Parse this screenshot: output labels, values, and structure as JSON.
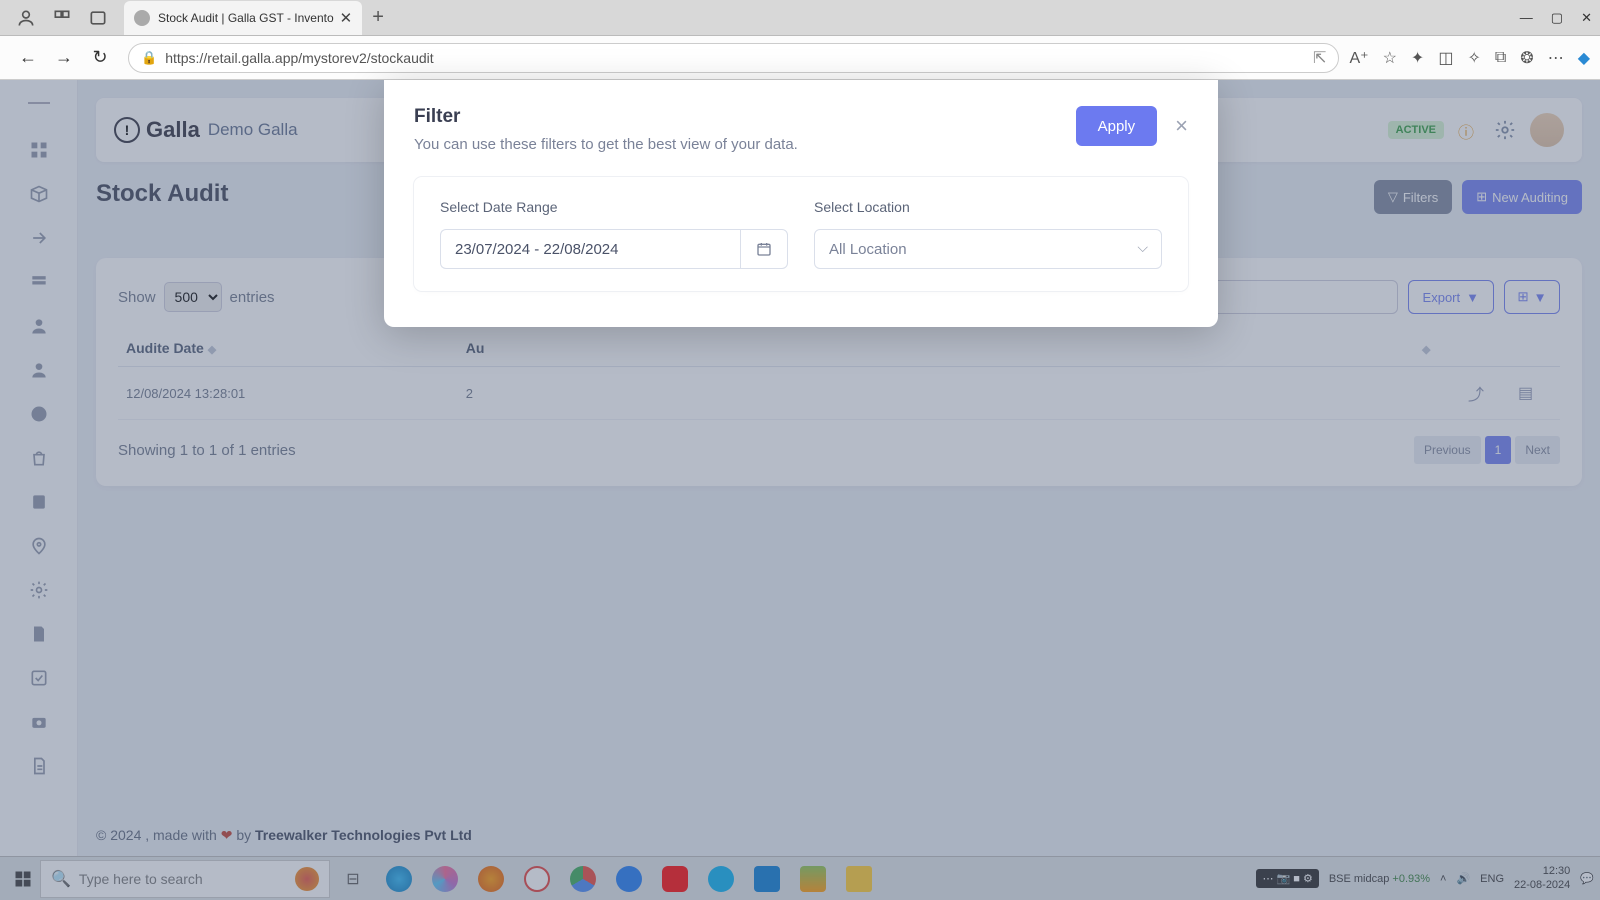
{
  "browser": {
    "tab_title": "Stock Audit | Galla GST - Invento",
    "url": "https://retail.galla.app/mystorev2/stockaudit"
  },
  "app": {
    "logo_text": "Galla",
    "store_name": "Demo Galla",
    "status_badge": "ACTIVE"
  },
  "page": {
    "title": "Stock Audit",
    "filters_button": "Filters",
    "new_button": "New Auditing"
  },
  "table": {
    "show_label_pre": "Show",
    "show_value": "500",
    "show_label_post": "entries",
    "export_label": "Export",
    "search_placeholder": "",
    "columns": {
      "c0": "Audite Date",
      "c1": "Au"
    },
    "rows": [
      {
        "date": "12/08/2024 13:28:01",
        "c1": "2"
      }
    ],
    "footer_info": "Showing 1 to 1 of 1 entries",
    "pager": {
      "prev": "Previous",
      "page": "1",
      "next": "Next"
    }
  },
  "footer": {
    "pre": "© 2024 , made with ",
    "heart": "❤",
    "mid": " by ",
    "company": "Treewalker Technologies Pvt Ltd"
  },
  "modal": {
    "title": "Filter",
    "subtitle": "You can use these filters to get the best view of your data.",
    "apply": "Apply",
    "date_label": "Select Date Range",
    "date_value": "23/07/2024 - 22/08/2024",
    "location_label": "Select Location",
    "location_value": "All Location"
  },
  "taskbar": {
    "search_placeholder": "Type here to search",
    "stock": "BSE midcap",
    "stock_change": "+0.93%",
    "lang": "ENG",
    "time": "12:30",
    "date": "22-08-2024"
  }
}
